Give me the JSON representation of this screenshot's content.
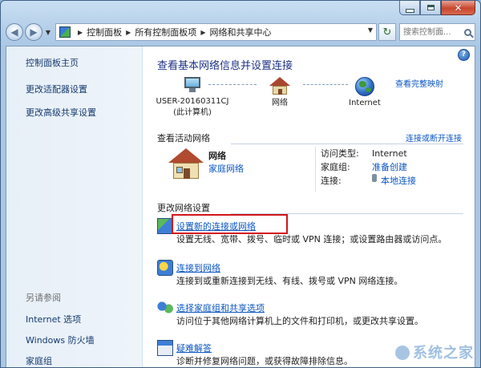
{
  "window": {
    "address": {
      "crumbs": [
        "控制面板",
        "所有控制面板项",
        "网络和共享中心"
      ]
    },
    "search_placeholder": "搜索控制面...",
    "help_label": "?"
  },
  "sidebar": {
    "top_items": [
      {
        "label": "控制面板主页"
      },
      {
        "label": "更改适配器设置"
      },
      {
        "label": "更改高级共享设置"
      }
    ],
    "see_also_label": "另请参阅",
    "see_also_items": [
      {
        "label": "Internet 选项"
      },
      {
        "label": "Windows 防火墙"
      },
      {
        "label": "家庭组"
      }
    ]
  },
  "main": {
    "title": "查看基本网络信息并设置连接",
    "view_full_map": "查看完整映射",
    "map": {
      "computer_name": "USER-20160311CJ",
      "computer_sub": "(此计算机)",
      "network_label": "网络",
      "internet_label": "Internet"
    },
    "active_networks": {
      "header": "查看活动网络",
      "connect_disconnect": "连接或断开连接",
      "network_name": "网络",
      "network_type": "家庭网络",
      "props": [
        {
          "key": "访问类型:",
          "value": "Internet",
          "link": false
        },
        {
          "key": "家庭组:",
          "value": "准备创建",
          "link": true
        },
        {
          "key": "连接:",
          "value": "本地连接",
          "link": true
        }
      ]
    },
    "change_settings": {
      "header": "更改网络设置",
      "tasks": [
        {
          "title": "设置新的连接或网络",
          "desc": "设置无线、宽带、拨号、临时或 VPN 连接；或设置路由器或访问点。"
        },
        {
          "title": "连接到网络",
          "desc": "连接到或重新连接到无线、有线、拨号或 VPN 网络连接。"
        },
        {
          "title": "选择家庭组和共享选项",
          "desc": "访问位于其他网络计算机上的文件和打印机，或更改共享设置。"
        },
        {
          "title": "疑难解答",
          "desc": "诊断并修复网络问题，或获得故障排除信息。"
        }
      ]
    }
  },
  "watermark": "系统之家"
}
